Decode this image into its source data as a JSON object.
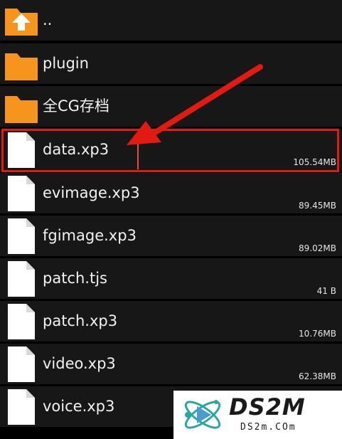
{
  "files": [
    {
      "name": "..",
      "size": "",
      "icon": "folder-up-icon"
    },
    {
      "name": "plugin",
      "size": "",
      "icon": "folder-icon"
    },
    {
      "name": "全CG存档",
      "size": "",
      "icon": "folder-icon"
    },
    {
      "name": "data.xp3",
      "size": "105.54MB",
      "icon": "file-icon",
      "highlighted": true
    },
    {
      "name": "evimage.xp3",
      "size": "89.45MB",
      "icon": "file-icon"
    },
    {
      "name": "fgimage.xp3",
      "size": "89.02MB",
      "icon": "file-icon"
    },
    {
      "name": "patch.tjs",
      "size": "41 B",
      "icon": "file-icon"
    },
    {
      "name": "patch.xp3",
      "size": "10.76MB",
      "icon": "file-icon"
    },
    {
      "name": "video.xp3",
      "size": "62.38MB",
      "icon": "file-icon"
    },
    {
      "name": "voice.xp3",
      "size": "",
      "icon": "file-icon"
    }
  ],
  "watermark": {
    "title": "DS2M",
    "subtitle": "DS2m.COm"
  },
  "colors": {
    "folder": "#f7941d",
    "highlight": "#e11b12",
    "row_bg": "#171717",
    "file_icon": "#ffffff"
  }
}
